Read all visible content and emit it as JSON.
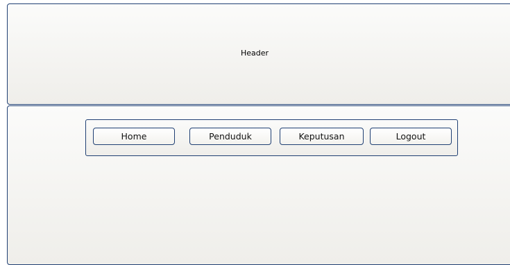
{
  "header": {
    "label": "Header"
  },
  "nav": {
    "items": [
      {
        "label": "Home"
      },
      {
        "label": "Penduduk"
      },
      {
        "label": "Keputusan"
      },
      {
        "label": "Logout"
      }
    ]
  },
  "colors": {
    "border": "#1f3f73",
    "panel_top": "#fbfbfa",
    "panel_bottom": "#efeeea"
  }
}
